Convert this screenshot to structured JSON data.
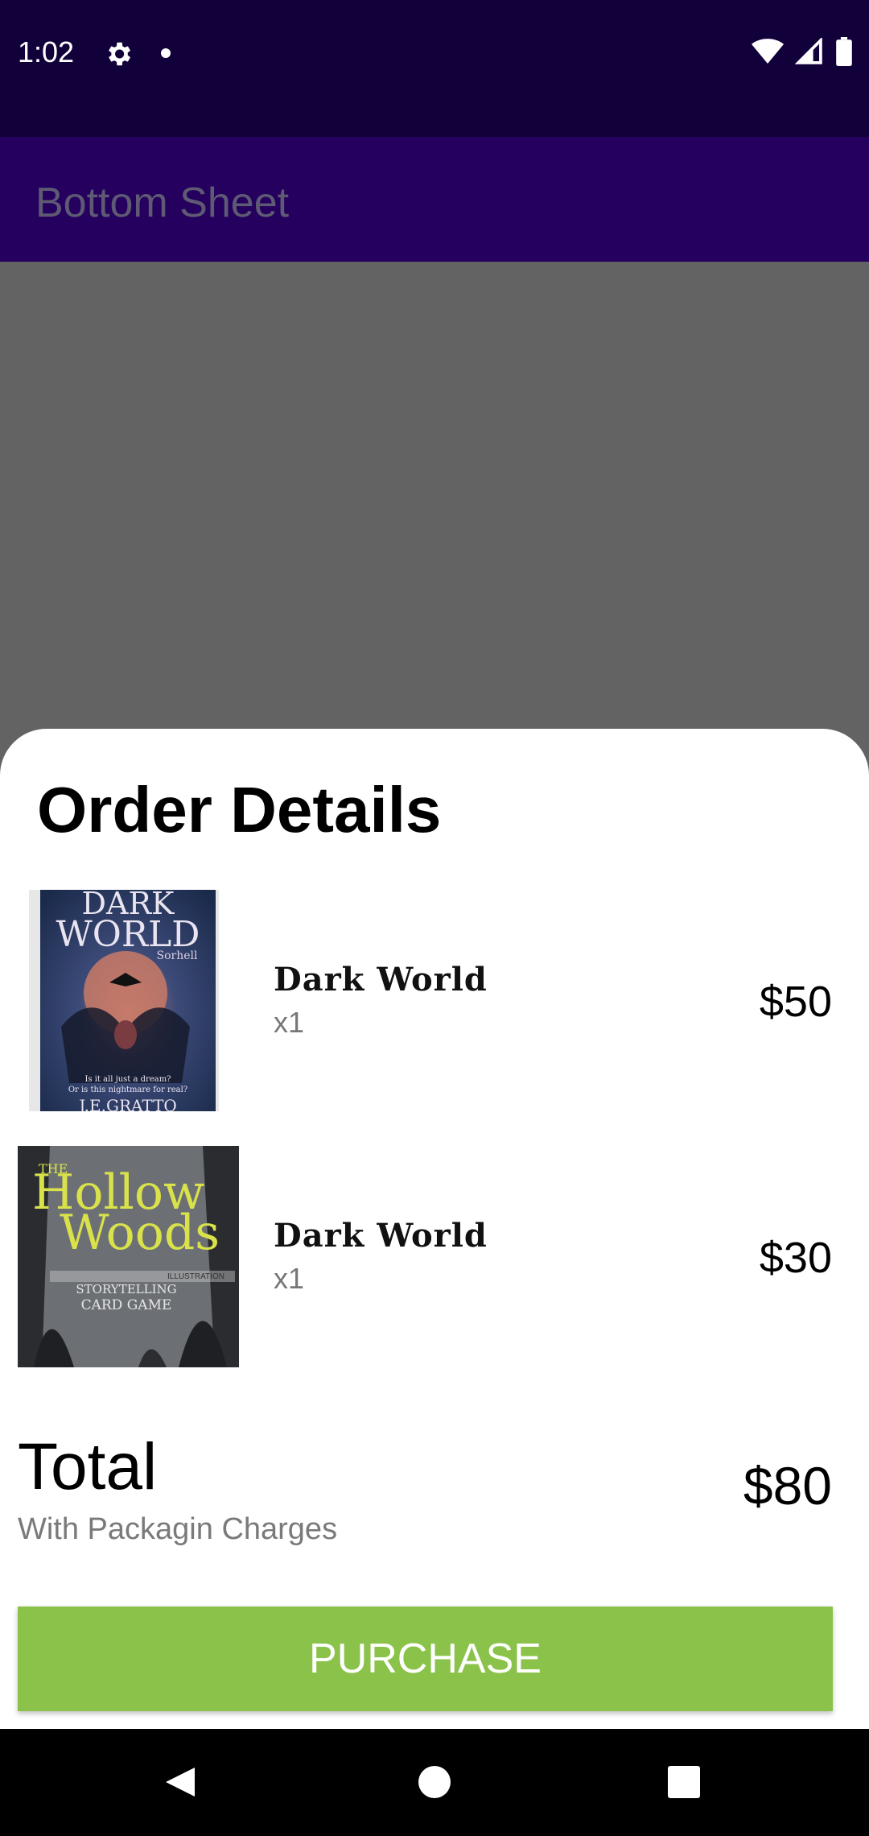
{
  "status_bar": {
    "time": "1:02",
    "icons": [
      "gear-icon",
      "notification-dot-icon",
      "wifi-icon",
      "signal-icon",
      "battery-icon"
    ]
  },
  "app_bar": {
    "title": "Bottom Sheet"
  },
  "sheet": {
    "title": "Order Details",
    "items": [
      {
        "name": "Dark World",
        "qty": "x1",
        "price": "$50",
        "cover": "dark-world-book-cover"
      },
      {
        "name": "Dark World",
        "qty": "x1",
        "price": "$30",
        "cover": "hollow-woods-book-cover"
      }
    ],
    "total": {
      "label": "Total",
      "subtitle": "With Packagin Charges",
      "value": "$80"
    },
    "purchase_label": "PURCHASE"
  },
  "cover_text": {
    "dark_world_title_1": "DARK",
    "dark_world_title_2": "WORLD",
    "dark_world_author_top": "Sorhell",
    "dark_world_tagline_1": "Is it all just a dream?",
    "dark_world_tagline_2": "Or is this nightmare for real?",
    "dark_world_author": "J.E.GRATTO",
    "hollow_the": "THE",
    "hollow_title_1": "Hollow",
    "hollow_title_2": "Woods",
    "hollow_badge": "ILLUSTRATION",
    "hollow_sub_1": "STORYTELLING",
    "hollow_sub_2": "CARD GAME"
  },
  "colors": {
    "status_bar": "#12003a",
    "app_bar": "#25005f",
    "scrim": "#636363",
    "purchase_button": "#8bc34a"
  },
  "nav_bar": {
    "icons": [
      "back-icon",
      "home-icon",
      "recents-icon"
    ]
  }
}
